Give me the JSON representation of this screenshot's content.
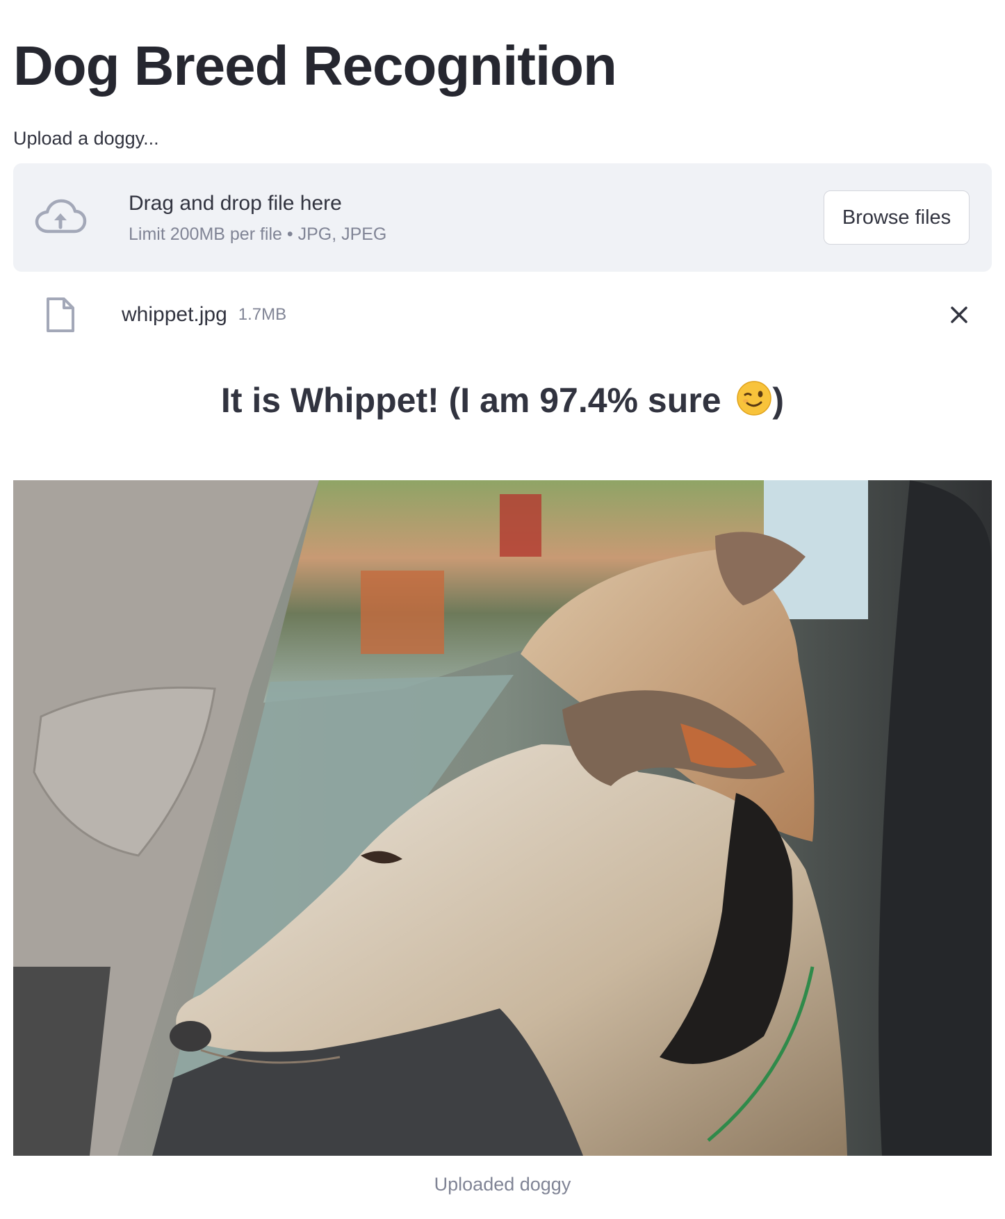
{
  "page": {
    "title": "Dog Breed Recognition",
    "upload_label": "Upload a doggy..."
  },
  "uploader": {
    "drop_text": "Drag and drop file here",
    "limit_text": "Limit 200MB per file • JPG, JPEG",
    "browse_label": "Browse files",
    "icon": "cloud-upload-icon"
  },
  "file": {
    "name": "whippet.jpg",
    "size": "1.7MB",
    "icon": "file-icon",
    "remove_icon": "close-icon"
  },
  "result": {
    "text": "It is Whippet! (I am 97.4% sure ",
    "closing": ")",
    "emoji": "winking-face"
  },
  "image": {
    "caption": "Uploaded doggy"
  },
  "colors": {
    "text": "#31333f",
    "muted": "#808495",
    "dropzone_bg": "#f0f2f6",
    "icon": "#a3a8b8"
  }
}
